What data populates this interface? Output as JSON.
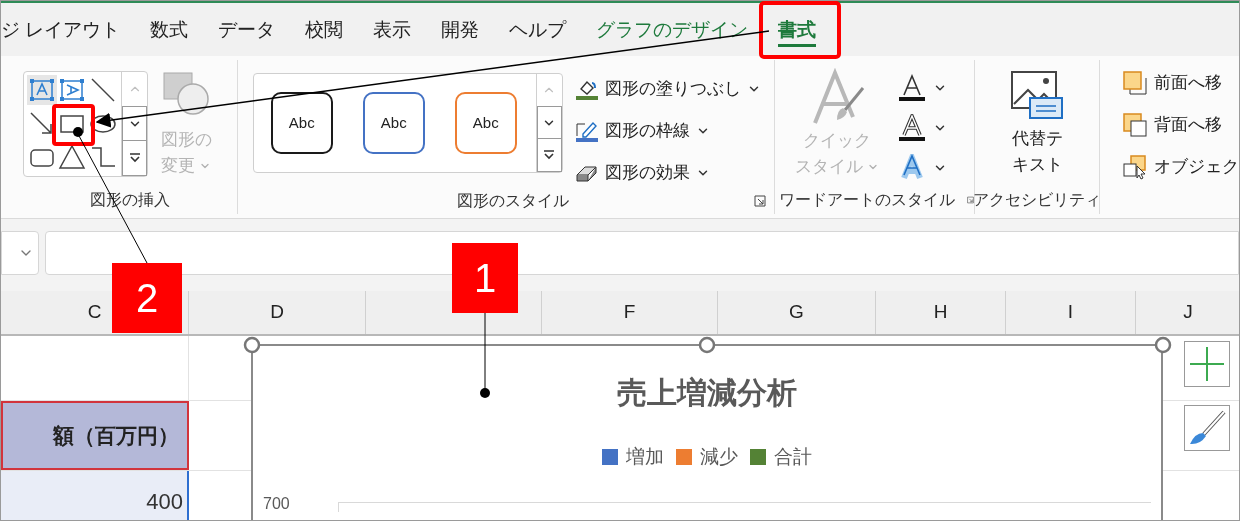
{
  "ribbon_tabs": [
    {
      "label": "ジ レイアウト",
      "selected": false,
      "kind": "normal"
    },
    {
      "label": "数式",
      "selected": false,
      "kind": "normal"
    },
    {
      "label": "データ",
      "selected": false,
      "kind": "normal"
    },
    {
      "label": "校閲",
      "selected": false,
      "kind": "normal"
    },
    {
      "label": "表示",
      "selected": false,
      "kind": "normal"
    },
    {
      "label": "開発",
      "selected": false,
      "kind": "normal"
    },
    {
      "label": "ヘルプ",
      "selected": false,
      "kind": "normal"
    },
    {
      "label": "グラフのデザイン",
      "selected": false,
      "kind": "context"
    },
    {
      "label": "書式",
      "selected": true,
      "kind": "context"
    }
  ],
  "ribbon": {
    "insert_shapes": {
      "label": "図形の挿入",
      "change_shape": {
        "label_lines": [
          "図形の",
          "変更"
        ],
        "disabled": true
      }
    },
    "shape_styles": {
      "label": "図形のスタイル",
      "presets": [
        {
          "text": "Abc",
          "color": "#1a1a1a"
        },
        {
          "text": "Abc",
          "color": "#4472c4"
        },
        {
          "text": "Abc",
          "color": "#ed7d31"
        }
      ],
      "commands": [
        "図形の塗りつぶし",
        "図形の枠線",
        "図形の効果"
      ]
    },
    "wordart_styles": {
      "label": "ワードアートのスタイル",
      "quick_style": {
        "label_lines": [
          "クイック",
          "スタイル"
        ],
        "disabled": true
      }
    },
    "accessibility": {
      "label": "アクセシビリティ",
      "alt_text": {
        "label_lines": [
          "代替テ",
          "キスト"
        ]
      }
    },
    "arrange": {
      "commands": [
        "前面へ移",
        "背面へ移",
        "オブジェク"
      ]
    }
  },
  "columns": [
    "C",
    "D",
    "F",
    "G",
    "H",
    "I",
    "J"
  ],
  "cells": {
    "header": "額（百万円）",
    "value": "400"
  },
  "chart": {
    "title": "売上増減分析",
    "legend": [
      {
        "label": "増加",
        "color": "#4472c4"
      },
      {
        "label": "減少",
        "color": "#ed7d31"
      },
      {
        "label": "合計",
        "color": "#548235"
      }
    ],
    "axis_label": "700"
  },
  "callouts": [
    {
      "number": "1"
    },
    {
      "number": "2"
    }
  ]
}
